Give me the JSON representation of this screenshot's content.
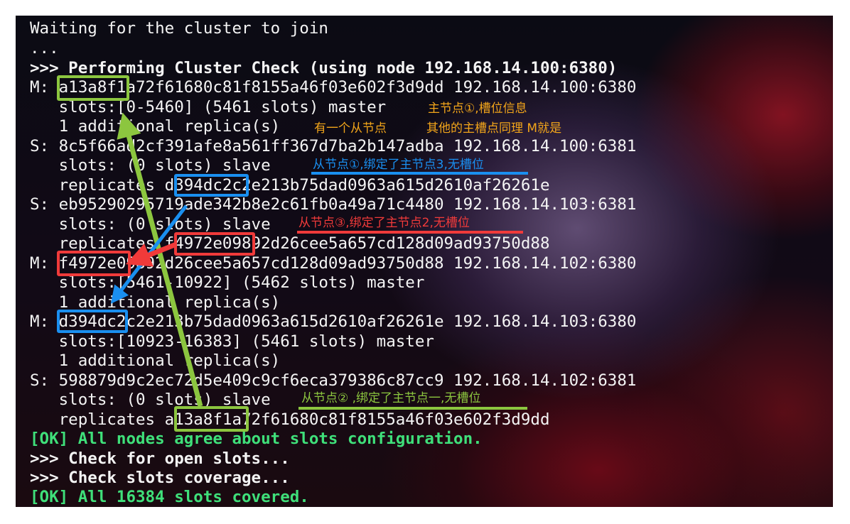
{
  "terminal": {
    "lines": [
      "Waiting for the cluster to join",
      "...",
      ">>> Performing Cluster Check (using node 192.168.14.100:6380)",
      "M: a13a8f1a72f61680c81f8155a46f03e602f3d9dd 192.168.14.100:6380",
      "   slots:[0-5460] (5461 slots) master",
      "   1 additional replica(s)",
      "S: 8c5f66ad2cf391afe8a561ff367d7ba2b147adba 192.168.14.100:6381",
      "   slots: (0 slots) slave",
      "   replicates d394dc2c2e213b75dad0963a615d2610af26261e",
      "S: eb95290295719ade342b8e2c61fb0a49a71c4480 192.168.14.103:6381",
      "   slots: (0 slots) slave",
      "   replicates f4972e09892d26cee5a657cd128d09ad93750d88",
      "M: f4972e09892d26cee5a657cd128d09ad93750d88 192.168.14.102:6380",
      "   slots:[5461-10922] (5462 slots) master",
      "   1 additional replica(s)",
      "M: d394dc2c2e213b75dad0963a615d2610af26261e 192.168.14.103:6380",
      "   slots:[10923-16383] (5461 slots) master",
      "   1 additional replica(s)",
      "S: 598879d9c2ec72d5e409c9cf6eca379386c87cc9 192.168.14.102:6381",
      "   slots: (0 slots) slave",
      "   replicates a13a8f1a72f61680c81f8155a46f03e602f3d9dd",
      "[OK] All nodes agree about slots configuration.",
      ">>> Check for open slots...",
      ">>> Check slots coverage...",
      "[OK] All 16384 slots covered."
    ]
  },
  "annotations": {
    "master1_slots": "主节点①,槽位信息",
    "one_replica_note": "有一个从节点",
    "others_note": "其他的主槽点同理  M就是",
    "slave1_note": "从节点①,绑定了主节点3,无槽位",
    "slave3_note": "从节点③,绑定了主节点2,无槽位",
    "slave2_note": "从节点② ,绑定了主节点一,无槽位"
  },
  "colors": {
    "terminal_text": "#f4f4f4",
    "ok_text": "#3fe07a",
    "annotation_orange": "#f2a51a",
    "annotation_blue": "#1a8ff0",
    "annotation_red": "#f03a3a",
    "annotation_green": "#8cc63f"
  }
}
